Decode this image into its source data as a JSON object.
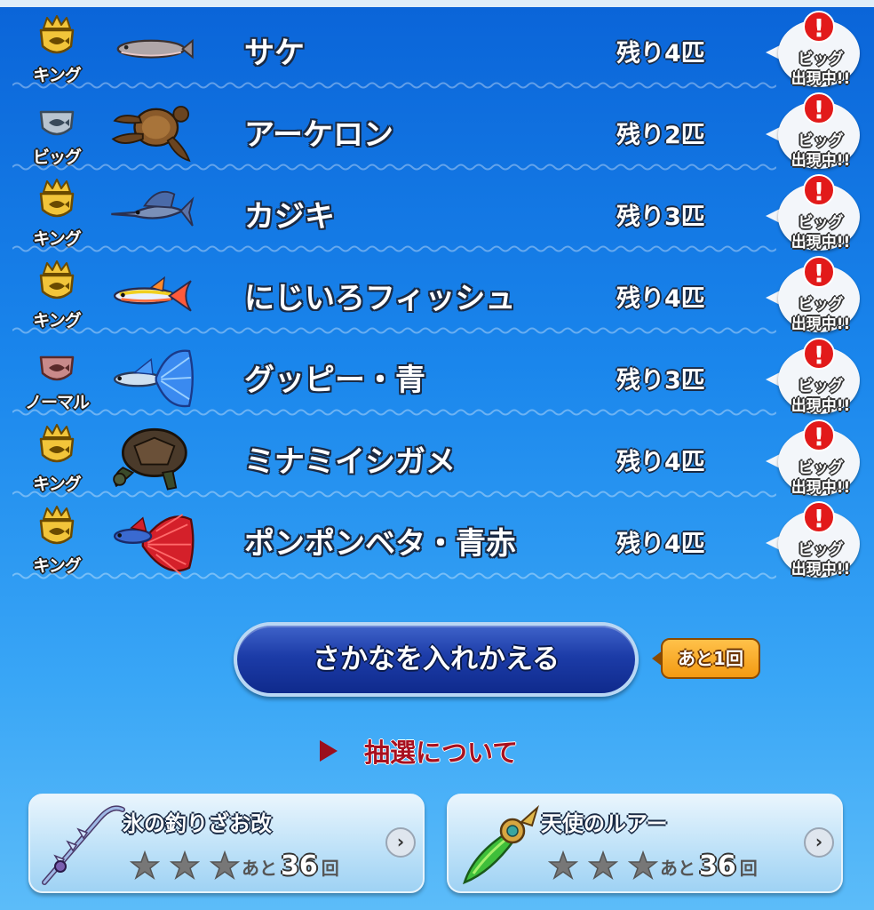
{
  "fish": [
    {
      "rank": "キング",
      "rank_type": "king",
      "name": "サケ",
      "remaining": "残り4匹",
      "bubble_line1": "ビッグ",
      "bubble_line2": "出現中!!",
      "fish_icon": "salmon-icon"
    },
    {
      "rank": "ビッグ",
      "rank_type": "big",
      "name": "アーケロン",
      "remaining": "残り2匹",
      "bubble_line1": "ビッグ",
      "bubble_line2": "出現中!!",
      "fish_icon": "sea-turtle-icon"
    },
    {
      "rank": "キング",
      "rank_type": "king",
      "name": "カジキ",
      "remaining": "残り3匹",
      "bubble_line1": "ビッグ",
      "bubble_line2": "出現中!!",
      "fish_icon": "marlin-icon"
    },
    {
      "rank": "キング",
      "rank_type": "king",
      "name": "にじいろフィッシュ",
      "remaining": "残り4匹",
      "bubble_line1": "ビッグ",
      "bubble_line2": "出現中!!",
      "fish_icon": "rainbow-fish-icon"
    },
    {
      "rank": "ノーマル",
      "rank_type": "normal",
      "name": "グッピー・青",
      "remaining": "残り3匹",
      "bubble_line1": "ビッグ",
      "bubble_line2": "出現中!!",
      "fish_icon": "guppy-icon"
    },
    {
      "rank": "キング",
      "rank_type": "king",
      "name": "ミナミイシガメ",
      "remaining": "残り4匹",
      "bubble_line1": "ビッグ",
      "bubble_line2": "出現中!!",
      "fish_icon": "pond-turtle-icon"
    },
    {
      "rank": "キング",
      "rank_type": "king",
      "name": "ポンポンベタ・青赤",
      "remaining": "残り4匹",
      "bubble_line1": "ビッグ",
      "bubble_line2": "出現中!!",
      "fish_icon": "betta-icon"
    }
  ],
  "alert_glyph": "!",
  "swap_button": {
    "label": "さかなを入れかえる"
  },
  "remaining_badge": {
    "label": "あと1回"
  },
  "lottery_link": {
    "label": "抽選について"
  },
  "equipment": [
    {
      "name": "氷の釣りざお改",
      "icon": "ice-fishing-rod-icon",
      "stars": 3,
      "uses_prefix": "あと",
      "uses_count": "36",
      "uses_suffix": "回",
      "arrow": "›"
    },
    {
      "name": "天使のルアー",
      "icon": "angel-lure-icon",
      "stars": 3,
      "uses_prefix": "あと",
      "uses_count": "36",
      "uses_suffix": "回",
      "arrow": "›"
    }
  ],
  "colors": {
    "background_top": "#0a64d8",
    "background_bottom": "#5cbcf9",
    "alert_red": "#e21a1a",
    "link_red": "#a8101f",
    "button_blue": "#1c3ca8",
    "badge_orange": "#f39a12"
  }
}
